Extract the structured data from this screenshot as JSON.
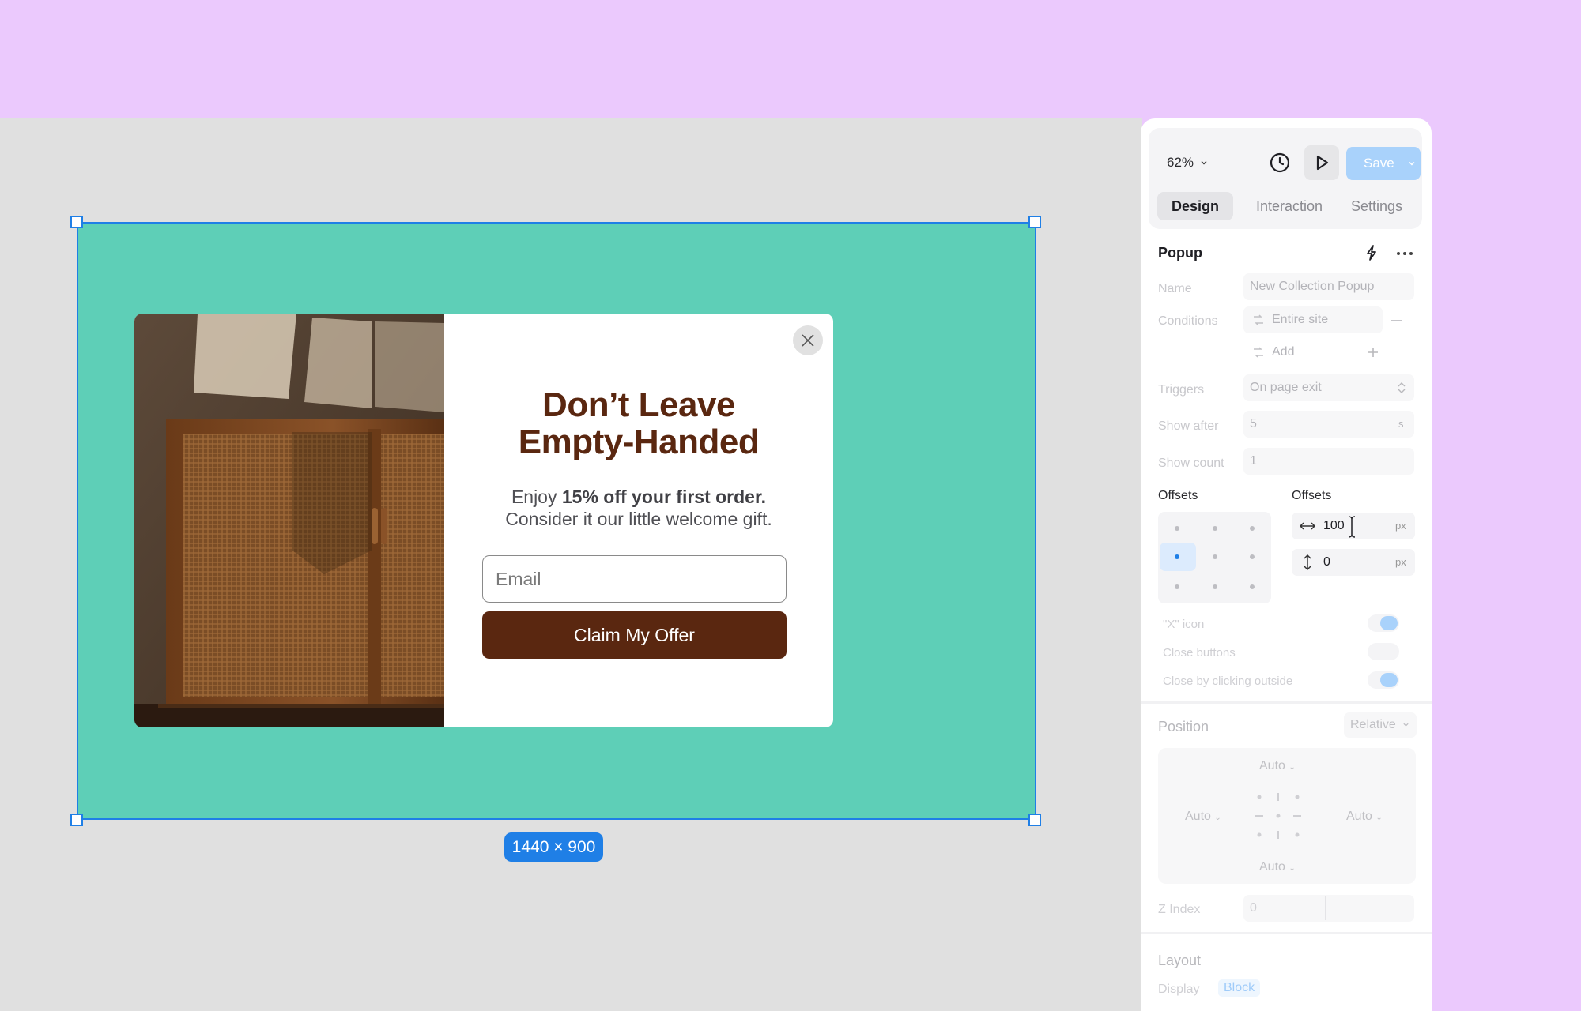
{
  "canvas": {
    "frame_size": "1440 × 900",
    "popup": {
      "title_line1": "Don’t Leave",
      "title_line2": "Empty-Handed",
      "subtitle_pre": "Enjoy ",
      "subtitle_bold": "15% off your first order.",
      "subtitle_line2": "Consider it our little welcome gift.",
      "email_placeholder": "Email",
      "cta_label": "Claim My Offer",
      "close_icon": "close-icon"
    }
  },
  "toolbar": {
    "zoom": "62%",
    "save_label": "Save",
    "icons": [
      "history-icon",
      "play-icon",
      "chevron-down-icon"
    ]
  },
  "tabs": [
    "Design",
    "Interaction",
    "Settings"
  ],
  "popup_panel": {
    "title": "Popup",
    "name_label": "Name",
    "name_value": "New Collection Popup",
    "conditions_label": "Conditions",
    "condition_value": "Entire site",
    "add_label": "Add",
    "triggers_label": "Triggers",
    "trigger_value": "On page exit",
    "show_after_label": "Show after",
    "show_after_value": "5",
    "show_after_unit": "s",
    "show_count_label": "Show count",
    "show_count_value": "1",
    "offsets_label_left": "Offsets",
    "offsets_label_right": "Offsets",
    "offset_x": "100",
    "offset_y": "0",
    "offset_unit": "px",
    "x_icon_label": "\"X\" icon",
    "close_buttons_label": "Close buttons",
    "close_outside_label": "Close by clicking outside",
    "x_icon_on": true,
    "close_buttons_on": false,
    "close_outside_on": true
  },
  "position_panel": {
    "title": "Position",
    "mode": "Relative",
    "top": "Auto",
    "left": "Auto",
    "right": "Auto",
    "bottom": "Auto",
    "z_index_label": "Z Index",
    "z_index_value": "0"
  },
  "layout_panel": {
    "title": "Layout",
    "display_label": "Display",
    "display_value": "Block"
  },
  "colors": {
    "background": "#ebc9fd",
    "canvas": "#e0e0e0",
    "frame": "#5ecfb7",
    "selection": "#1f7fe6",
    "brand_brown": "#5a2710",
    "save_disabled": "#a9d2fb"
  }
}
